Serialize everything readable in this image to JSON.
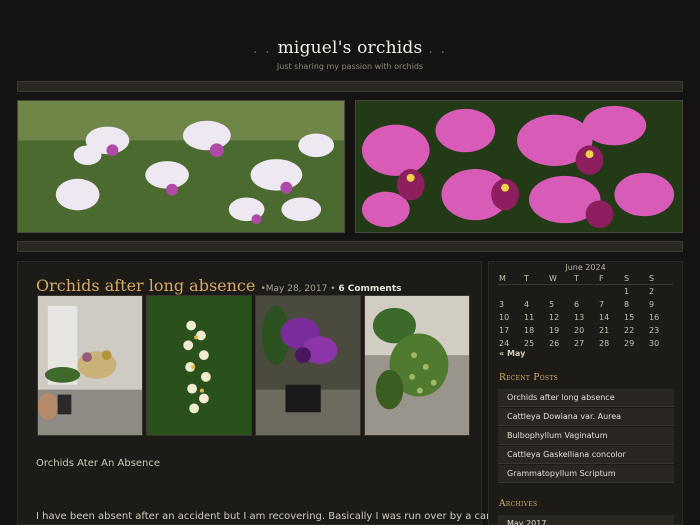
{
  "site": {
    "title_dots_left": ". . ",
    "title": "miguel's orchids",
    "title_dots_right": " . .",
    "tagline": "Just sharing my passion with orchids"
  },
  "post": {
    "title": "Orchids after long absence",
    "date": "May 28, 2017",
    "separator": "•",
    "comments": "6 Comments",
    "subhead": "Orchids Ater An Absence",
    "body_excerpt": "I have been absent after an accident  but I am recovering. Basically I was run over by a car"
  },
  "calendar": {
    "caption": "June 2024",
    "days": [
      "M",
      "T",
      "W",
      "T",
      "F",
      "S",
      "S"
    ],
    "weeks": [
      [
        "",
        "",
        "",
        "",
        "",
        "1",
        "2"
      ],
      [
        "3",
        "4",
        "5",
        "6",
        "7",
        "8",
        "9"
      ],
      [
        "10",
        "11",
        "12",
        "13",
        "14",
        "15",
        "16"
      ],
      [
        "17",
        "18",
        "19",
        "20",
        "21",
        "22",
        "23"
      ],
      [
        "24",
        "25",
        "26",
        "27",
        "28",
        "29",
        "30"
      ]
    ],
    "prev_link": "« May"
  },
  "recent_posts": {
    "title": "Recent Posts",
    "items": [
      "Orchids after long absence",
      "Cattleya Dowiana var. Aurea",
      "Bulbophyllum Vaginatum",
      "Cattleya Gaskelliana concolor",
      "Grammatopyllum Scriptum"
    ]
  },
  "archives": {
    "title": "Archives",
    "items": [
      "May 2017"
    ]
  },
  "colors": {
    "accent": "#d7a964",
    "background": "#161412",
    "panel": "#1d1b18"
  }
}
